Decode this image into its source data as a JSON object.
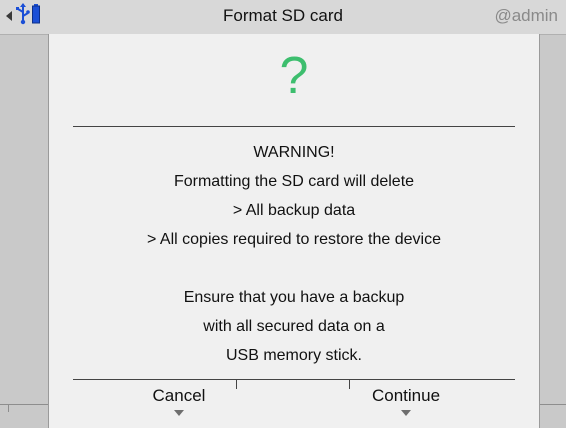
{
  "header": {
    "title": "Format SD card",
    "user": "@admin",
    "icons": [
      "back-arrow-icon",
      "usb-icon",
      "battery-icon"
    ]
  },
  "dialog": {
    "icon": "?",
    "icon_color": "#3dbe6e",
    "lines": [
      "WARNING!",
      "Formatting the SD card will delete",
      "> All backup data",
      "> All copies required to restore the device",
      "",
      "Ensure that you have a backup",
      "with all secured data on a",
      "USB memory stick."
    ],
    "cancel_label": "Cancel",
    "continue_label": "Continue"
  }
}
